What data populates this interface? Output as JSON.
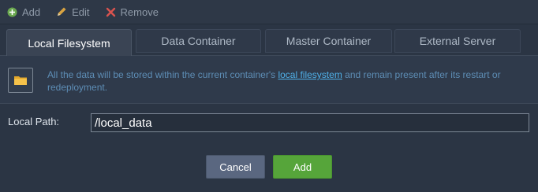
{
  "toolbar": {
    "add_label": "Add",
    "edit_label": "Edit",
    "remove_label": "Remove",
    "add_icon": "plus-circle-icon",
    "edit_icon": "pencil-icon",
    "remove_icon": "x-icon"
  },
  "tabs": [
    {
      "label": "Local Filesystem",
      "active": true
    },
    {
      "label": "Data Container",
      "active": false
    },
    {
      "label": "Master Container",
      "active": false
    },
    {
      "label": "External Server",
      "active": false
    }
  ],
  "info": {
    "icon": "folder-icon",
    "text_before": "All the data will be stored within the current container's ",
    "link_text": "local filesystem",
    "text_after": " and remain present after its restart or redeployment."
  },
  "form": {
    "path_label": "Local Path:",
    "path_value": "/local_data"
  },
  "actions": {
    "cancel_label": "Cancel",
    "add_label": "Add"
  },
  "colors": {
    "accent_green": "#56a53a",
    "cancel_slate": "#5a6780",
    "link_blue": "#4fb0e8",
    "remove_red": "#d9534f"
  }
}
